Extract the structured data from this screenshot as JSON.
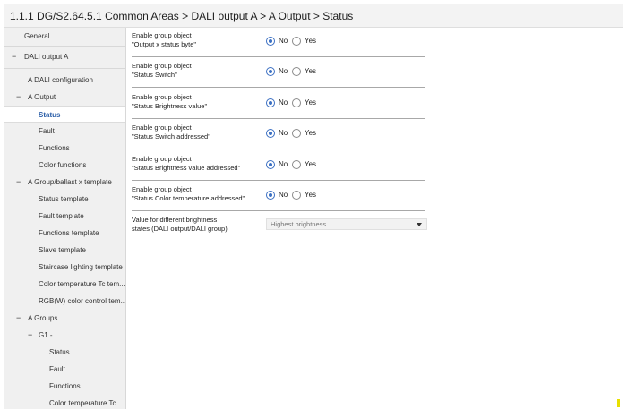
{
  "header": {
    "breadcrumb": "1.1.1 DG/S2.64.5.1 Common Areas > DALI output A > A Output > Status"
  },
  "sidebar": {
    "items": [
      {
        "label": "General",
        "toggle": ""
      },
      {
        "label": "DALI output A",
        "toggle": "−"
      },
      {
        "label": "A DALI configuration",
        "toggle": ""
      },
      {
        "label": "A Output",
        "toggle": "−"
      },
      {
        "label": "Status",
        "toggle": ""
      },
      {
        "label": "Fault",
        "toggle": ""
      },
      {
        "label": "Functions",
        "toggle": ""
      },
      {
        "label": "Color functions",
        "toggle": ""
      },
      {
        "label": "A Group/ballast x template",
        "toggle": "−"
      },
      {
        "label": "Status template",
        "toggle": ""
      },
      {
        "label": "Fault template",
        "toggle": ""
      },
      {
        "label": "Functions template",
        "toggle": ""
      },
      {
        "label": "Slave template",
        "toggle": ""
      },
      {
        "label": "Staircase lighting template",
        "toggle": ""
      },
      {
        "label": "Color temperature Tc tem...",
        "toggle": ""
      },
      {
        "label": "RGB(W) color control tem...",
        "toggle": ""
      },
      {
        "label": "A Groups",
        "toggle": "−"
      },
      {
        "label": "G1 -",
        "toggle": "−"
      },
      {
        "label": "Status",
        "toggle": ""
      },
      {
        "label": "Fault",
        "toggle": ""
      },
      {
        "label": "Functions",
        "toggle": ""
      },
      {
        "label": "Color temperature Tc",
        "toggle": ""
      }
    ]
  },
  "params": {
    "rows": [
      {
        "line1": "Enable group object",
        "line2": "\"Output x status byte\"",
        "no": "No",
        "yes": "Yes",
        "selected": "No"
      },
      {
        "line1": "Enable group object",
        "line2": "\"Status Switch\"",
        "no": "No",
        "yes": "Yes",
        "selected": "No"
      },
      {
        "line1": "Enable group object",
        "line2": "\"Status Brightness value\"",
        "no": "No",
        "yes": "Yes",
        "selected": "No"
      },
      {
        "line1": "Enable group object",
        "line2": "\"Status Switch addressed\"",
        "no": "No",
        "yes": "Yes",
        "selected": "No"
      },
      {
        "line1": "Enable group object",
        "line2": "\"Status Brightness value addressed\"",
        "no": "No",
        "yes": "Yes",
        "selected": "No"
      },
      {
        "line1": "Enable group object",
        "line2": "\"Status Color temperature addressed\"",
        "no": "No",
        "yes": "Yes",
        "selected": "No"
      }
    ],
    "brightness": {
      "line1": "Value for different brightness",
      "line2": "states (DALI output/DALI group)",
      "value": "Highest brightness"
    }
  },
  "colors": {
    "accent": "#3b6fc2",
    "selected_text": "#2a5ea8",
    "sidebar_bg": "#f0f0f0"
  }
}
